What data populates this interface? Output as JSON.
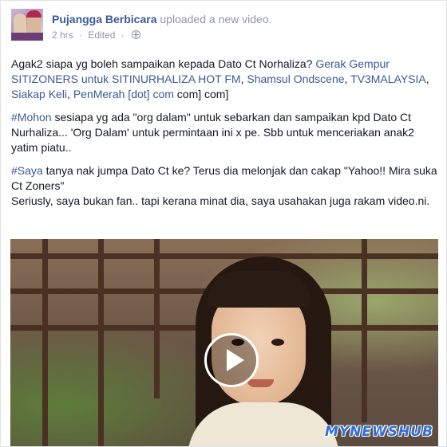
{
  "post": {
    "author": "Pujangga Berbicara",
    "action": "uploaded a new video.",
    "time": "2 hrs",
    "separator": "·",
    "edited": "Edited",
    "privacy_icon": "globe-icon",
    "colors": {
      "link": "#3b5998",
      "text": "#141823",
      "meta": "#9197a3",
      "watermark": "#2f6fd6"
    }
  },
  "paragraph1": {
    "text": "Agak2 siapa yg boleh sampaikan kepada Dato Ct Norhaliza? ",
    "tags": [
      {
        "text": "Gerak Gempur SITIZONERS untuk SITINURHALIZA HOT FM"
      },
      {
        "text": "Shamsul Ondscene"
      },
      {
        "text": "TV3MALAYSIA"
      },
      {
        "text": "Siakap Keli"
      },
      {
        "text": "PenMerah [dot] com"
      }
    ],
    "sep": ", ",
    "tail": " com] com]"
  },
  "paragraph2": {
    "hashtag": "#Mohon",
    "text": " sesiapa yg ada \"org dalam\" untuk sebarkan dan sampaikan kpd Dato Ct Nurhaliza... 'Org Dalam' untuk permintaan ini x pe. Sbb untuk menceriakan anak2 yatim piatu.."
  },
  "paragraph3": {
    "hashtag": "#Saya",
    "line1": " tanya nak jumpa Dato Ct ke? Terus dia melonjak dan cakap \"Yahoo!! Mira suka Ct Zoners\"",
    "line2": "Seriusly, saya bukan fan.. tapi kerana minat dia, saya usahakan juga rakam video.ni."
  },
  "video": {
    "play_icon": "play-icon",
    "watermark": "MYNEWSHUB"
  }
}
